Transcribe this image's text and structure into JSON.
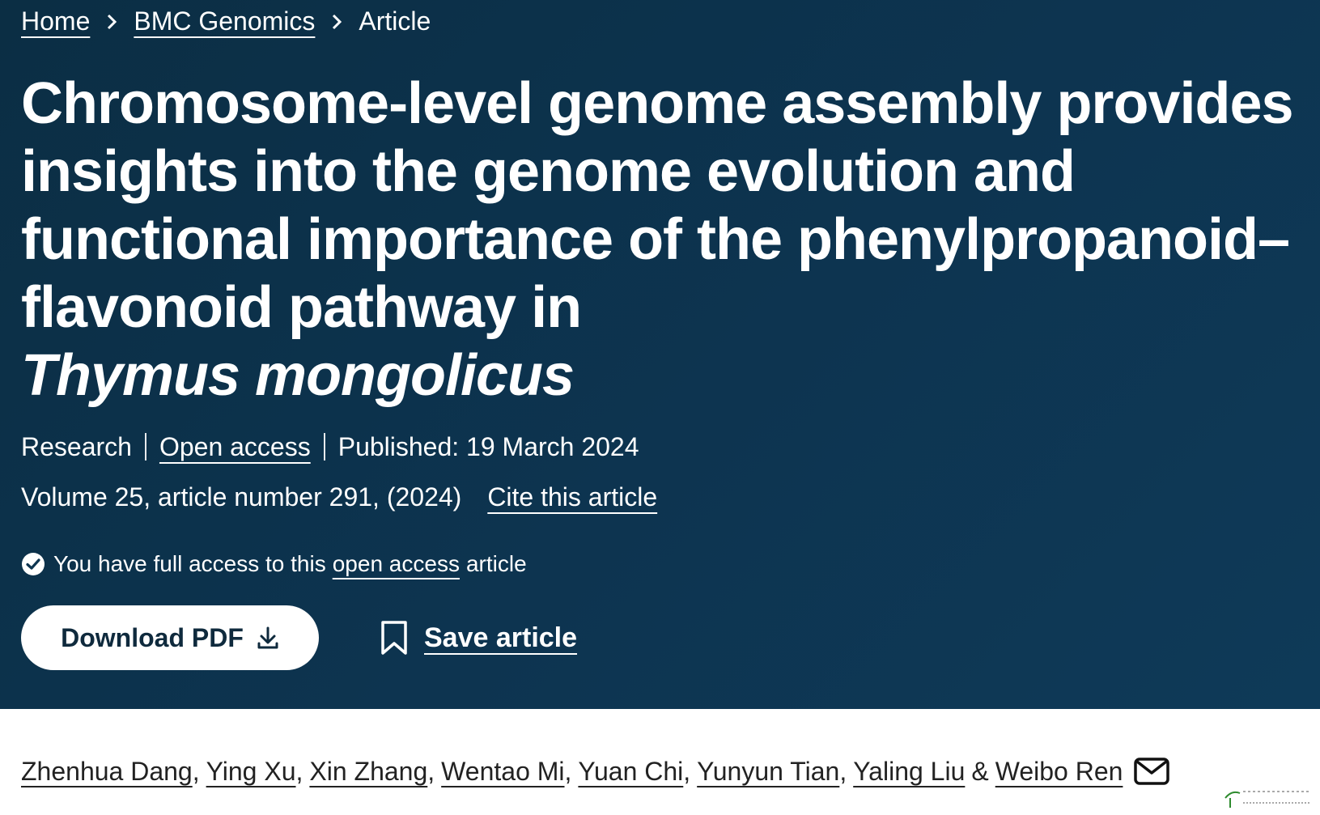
{
  "breadcrumb": {
    "home": "Home",
    "journal": "BMC Genomics",
    "current": "Article"
  },
  "article": {
    "title_main": "Chromosome-level genome assembly provides insights into the genome evolution and functional importance of the phenylpropanoid–flavonoid pathway in",
    "title_species": "Thymus mongolicus",
    "type": "Research",
    "access_label": "Open access",
    "published": "Published: 19 March 2024",
    "volume_info": "Volume 25, article number 291, (2024)",
    "cite_label": "Cite this article"
  },
  "access_notice": {
    "prefix": "You have full access to this",
    "link": "open access",
    "suffix": "article"
  },
  "actions": {
    "download_label": "Download PDF",
    "save_label": "Save article"
  },
  "authors": {
    "list": [
      "Zhenhua Dang",
      "Ying Xu",
      "Xin Zhang",
      "Wentao Mi",
      "Yuan Chi",
      "Yunyun Tian",
      "Yaling Liu"
    ],
    "ampersand": "&",
    "last": "Weibo Ren"
  },
  "icons": {
    "breadcrumb_separator": "chevron-right-icon",
    "access": "check-circle-icon",
    "download": "download-icon",
    "save": "bookmark-icon",
    "contact": "mail-icon"
  },
  "colors": {
    "hero_background": "#0d3450",
    "button_background": "#ffffff",
    "button_text": "#0f2a3d",
    "author_text": "#222222"
  }
}
